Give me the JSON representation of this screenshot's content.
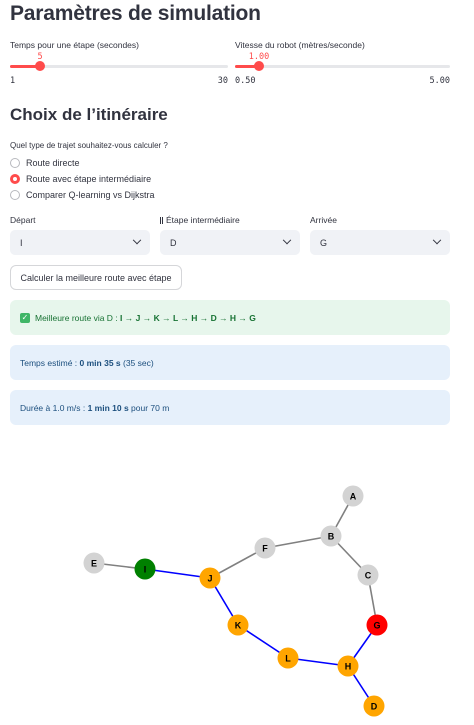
{
  "page": {
    "title": "Paramètres de simulation",
    "section_title": "Choix de l’itinéraire"
  },
  "sliders": [
    {
      "label": "Temps pour une étape (secondes)",
      "value": "5",
      "min": "1",
      "max": "30",
      "fraction": 0.138
    },
    {
      "label": "Vitesse du robot (mètres/seconde)",
      "value": "1.00",
      "min": "0.50",
      "max": "5.00",
      "fraction": 0.111
    }
  ],
  "route_type": {
    "question": "Quel type de trajet souhaitez-vous calculer ?",
    "options": [
      "Route directe",
      "Route avec étape intermédiaire",
      "Comparer Q-learning vs Dijkstra"
    ],
    "selected_index": 1
  },
  "selects": {
    "depart": {
      "label": "Départ",
      "value": "I"
    },
    "etape": {
      "label": "Étape intermédiaire",
      "value": "D"
    },
    "arrivee": {
      "label": "Arrivée",
      "value": "G"
    }
  },
  "compute_button": "Calculer la meilleure route avec étape",
  "results": {
    "best_route_prefix": "Meilleure route via D : ",
    "best_route_path": "I → J → K → L → H → D → H → G",
    "time_prefix": "Temps estimé : ",
    "time_bold": "0 min 35 s",
    "time_suffix": " (35 sec)",
    "duration_prefix": "Durée à ",
    "duration_speed": "1.0 m/s",
    "duration_mid": " : ",
    "duration_bold": "1 min 10 s",
    "duration_suffix": " pour 70 m"
  },
  "colors": {
    "accent": "#ff4b4b",
    "start": "#008000",
    "end": "#ff0000",
    "route": "#ffa500",
    "default": "#d3d3d3",
    "route_edge": "#0000ff",
    "edge": "#808080"
  },
  "graph": {
    "nodes": [
      {
        "id": "A",
        "role": "default"
      },
      {
        "id": "B",
        "role": "default"
      },
      {
        "id": "C",
        "role": "default"
      },
      {
        "id": "D",
        "role": "route"
      },
      {
        "id": "E",
        "role": "default"
      },
      {
        "id": "F",
        "role": "default"
      },
      {
        "id": "G",
        "role": "end"
      },
      {
        "id": "H",
        "role": "route"
      },
      {
        "id": "I",
        "role": "start"
      },
      {
        "id": "J",
        "role": "route"
      },
      {
        "id": "K",
        "role": "route"
      },
      {
        "id": "L",
        "role": "route"
      }
    ],
    "edges": [
      {
        "from": "A",
        "to": "B",
        "on_route": false
      },
      {
        "from": "B",
        "to": "F",
        "on_route": false
      },
      {
        "from": "B",
        "to": "C",
        "on_route": false
      },
      {
        "from": "C",
        "to": "G",
        "on_route": false
      },
      {
        "from": "F",
        "to": "J",
        "on_route": false
      },
      {
        "from": "E",
        "to": "I",
        "on_route": false
      },
      {
        "from": "I",
        "to": "J",
        "on_route": true
      },
      {
        "from": "J",
        "to": "K",
        "on_route": true
      },
      {
        "from": "K",
        "to": "L",
        "on_route": true
      },
      {
        "from": "L",
        "to": "H",
        "on_route": true
      },
      {
        "from": "H",
        "to": "D",
        "on_route": true
      },
      {
        "from": "H",
        "to": "G",
        "on_route": true
      }
    ]
  }
}
